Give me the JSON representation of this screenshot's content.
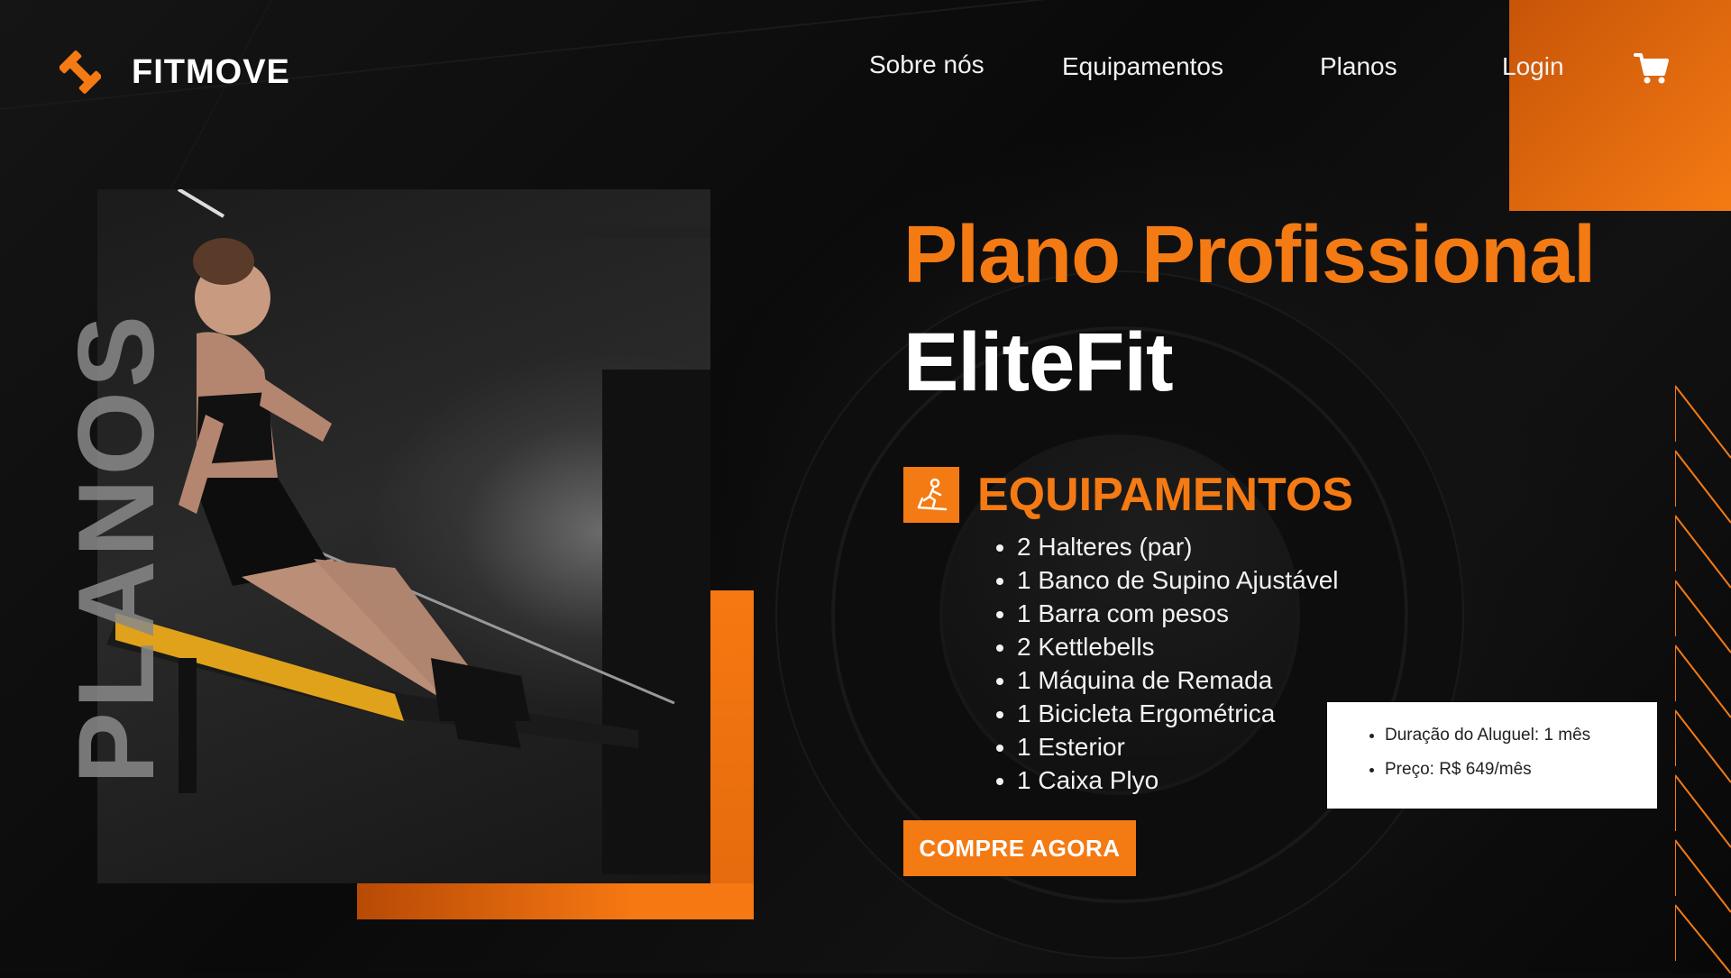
{
  "brand": {
    "name": "FITMOVE",
    "logo_icon": "dumbbell-icon",
    "accent": "#F47A13"
  },
  "nav": {
    "items": [
      {
        "label": "Sobre nós"
      },
      {
        "label": "Equipamentos"
      },
      {
        "label": "Planos"
      },
      {
        "label": "Login"
      }
    ],
    "cart_icon": "cart-icon"
  },
  "hero": {
    "side_word": "PLANOS",
    "title_line1": "Plano Profissional",
    "title_line2": "EliteFit"
  },
  "equipment": {
    "heading": "EQUIPAMENTOS",
    "icon": "treadmill-icon",
    "items": [
      "2 Halteres (par)",
      "1 Banco de Supino Ajustável",
      "1 Barra com pesos",
      "2 Kettlebells",
      "1 Máquina de Remada",
      "1 Bicicleta Ergométrica",
      "1 Esterior",
      "1 Caixa Plyo"
    ]
  },
  "cta": {
    "label": "COMPRE AGORA"
  },
  "rental": {
    "items": [
      "Duração do Aluguel: 1 mês",
      "Preço: R$ 649/mês"
    ]
  }
}
